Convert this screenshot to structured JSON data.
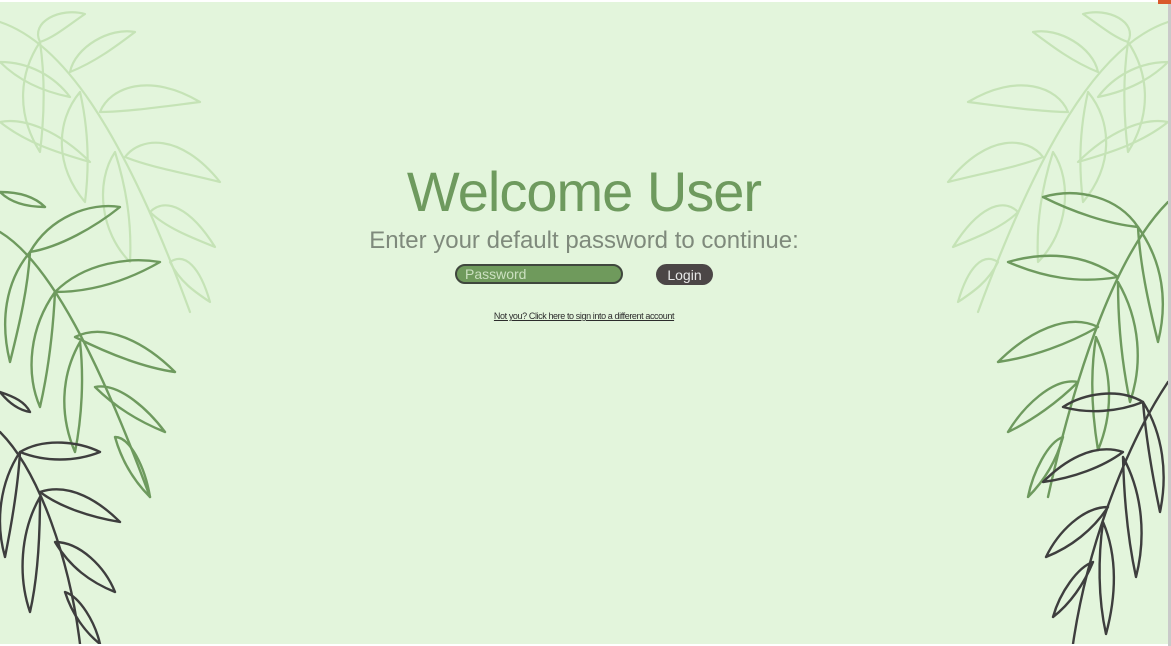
{
  "login": {
    "title": "Welcome User",
    "subtitle": "Enter your default password to continue:",
    "password_placeholder": "Password",
    "login_label": "Login",
    "switch_account_link": "Not you? Click here to sign into a different account"
  },
  "colors": {
    "background": "#e3f5dc",
    "title": "#6e9a5e",
    "input_fill": "#6f9a5c",
    "button_fill": "#4b4646",
    "leaf_light": "#c5e3b6",
    "leaf_mid": "#6e9a5e",
    "leaf_dark": "#3e3e3e"
  },
  "decorations": {
    "left": "palm-leaves-left",
    "right": "palm-leaves-right"
  }
}
